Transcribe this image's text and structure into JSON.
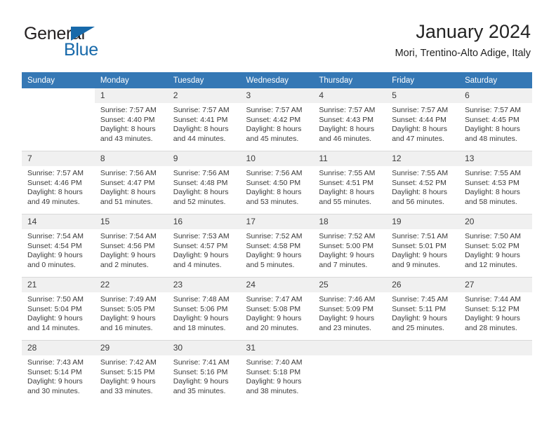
{
  "brand": {
    "name_part1": "General",
    "name_part2": "Blue",
    "triangle_color": "#1769aa"
  },
  "header": {
    "title": "January 2024",
    "subtitle": "Mori, Trentino-Alto Adige, Italy",
    "header_bg": "#3578b5",
    "daynum_bg": "#f0f0f0"
  },
  "weekdays": [
    "Sunday",
    "Monday",
    "Tuesday",
    "Wednesday",
    "Thursday",
    "Friday",
    "Saturday"
  ],
  "weeks": [
    [
      {
        "day": "",
        "blank": true,
        "l1": "",
        "l2": "",
        "l3": "",
        "l4": ""
      },
      {
        "day": "1",
        "l1": "Sunrise: 7:57 AM",
        "l2": "Sunset: 4:40 PM",
        "l3": "Daylight: 8 hours",
        "l4": "and 43 minutes."
      },
      {
        "day": "2",
        "l1": "Sunrise: 7:57 AM",
        "l2": "Sunset: 4:41 PM",
        "l3": "Daylight: 8 hours",
        "l4": "and 44 minutes."
      },
      {
        "day": "3",
        "l1": "Sunrise: 7:57 AM",
        "l2": "Sunset: 4:42 PM",
        "l3": "Daylight: 8 hours",
        "l4": "and 45 minutes."
      },
      {
        "day": "4",
        "l1": "Sunrise: 7:57 AM",
        "l2": "Sunset: 4:43 PM",
        "l3": "Daylight: 8 hours",
        "l4": "and 46 minutes."
      },
      {
        "day": "5",
        "l1": "Sunrise: 7:57 AM",
        "l2": "Sunset: 4:44 PM",
        "l3": "Daylight: 8 hours",
        "l4": "and 47 minutes."
      },
      {
        "day": "6",
        "l1": "Sunrise: 7:57 AM",
        "l2": "Sunset: 4:45 PM",
        "l3": "Daylight: 8 hours",
        "l4": "and 48 minutes."
      }
    ],
    [
      {
        "day": "7",
        "l1": "Sunrise: 7:57 AM",
        "l2": "Sunset: 4:46 PM",
        "l3": "Daylight: 8 hours",
        "l4": "and 49 minutes."
      },
      {
        "day": "8",
        "l1": "Sunrise: 7:56 AM",
        "l2": "Sunset: 4:47 PM",
        "l3": "Daylight: 8 hours",
        "l4": "and 51 minutes."
      },
      {
        "day": "9",
        "l1": "Sunrise: 7:56 AM",
        "l2": "Sunset: 4:48 PM",
        "l3": "Daylight: 8 hours",
        "l4": "and 52 minutes."
      },
      {
        "day": "10",
        "l1": "Sunrise: 7:56 AM",
        "l2": "Sunset: 4:50 PM",
        "l3": "Daylight: 8 hours",
        "l4": "and 53 minutes."
      },
      {
        "day": "11",
        "l1": "Sunrise: 7:55 AM",
        "l2": "Sunset: 4:51 PM",
        "l3": "Daylight: 8 hours",
        "l4": "and 55 minutes."
      },
      {
        "day": "12",
        "l1": "Sunrise: 7:55 AM",
        "l2": "Sunset: 4:52 PM",
        "l3": "Daylight: 8 hours",
        "l4": "and 56 minutes."
      },
      {
        "day": "13",
        "l1": "Sunrise: 7:55 AM",
        "l2": "Sunset: 4:53 PM",
        "l3": "Daylight: 8 hours",
        "l4": "and 58 minutes."
      }
    ],
    [
      {
        "day": "14",
        "l1": "Sunrise: 7:54 AM",
        "l2": "Sunset: 4:54 PM",
        "l3": "Daylight: 9 hours",
        "l4": "and 0 minutes."
      },
      {
        "day": "15",
        "l1": "Sunrise: 7:54 AM",
        "l2": "Sunset: 4:56 PM",
        "l3": "Daylight: 9 hours",
        "l4": "and 2 minutes."
      },
      {
        "day": "16",
        "l1": "Sunrise: 7:53 AM",
        "l2": "Sunset: 4:57 PM",
        "l3": "Daylight: 9 hours",
        "l4": "and 4 minutes."
      },
      {
        "day": "17",
        "l1": "Sunrise: 7:52 AM",
        "l2": "Sunset: 4:58 PM",
        "l3": "Daylight: 9 hours",
        "l4": "and 5 minutes."
      },
      {
        "day": "18",
        "l1": "Sunrise: 7:52 AM",
        "l2": "Sunset: 5:00 PM",
        "l3": "Daylight: 9 hours",
        "l4": "and 7 minutes."
      },
      {
        "day": "19",
        "l1": "Sunrise: 7:51 AM",
        "l2": "Sunset: 5:01 PM",
        "l3": "Daylight: 9 hours",
        "l4": "and 9 minutes."
      },
      {
        "day": "20",
        "l1": "Sunrise: 7:50 AM",
        "l2": "Sunset: 5:02 PM",
        "l3": "Daylight: 9 hours",
        "l4": "and 12 minutes."
      }
    ],
    [
      {
        "day": "21",
        "l1": "Sunrise: 7:50 AM",
        "l2": "Sunset: 5:04 PM",
        "l3": "Daylight: 9 hours",
        "l4": "and 14 minutes."
      },
      {
        "day": "22",
        "l1": "Sunrise: 7:49 AM",
        "l2": "Sunset: 5:05 PM",
        "l3": "Daylight: 9 hours",
        "l4": "and 16 minutes."
      },
      {
        "day": "23",
        "l1": "Sunrise: 7:48 AM",
        "l2": "Sunset: 5:06 PM",
        "l3": "Daylight: 9 hours",
        "l4": "and 18 minutes."
      },
      {
        "day": "24",
        "l1": "Sunrise: 7:47 AM",
        "l2": "Sunset: 5:08 PM",
        "l3": "Daylight: 9 hours",
        "l4": "and 20 minutes."
      },
      {
        "day": "25",
        "l1": "Sunrise: 7:46 AM",
        "l2": "Sunset: 5:09 PM",
        "l3": "Daylight: 9 hours",
        "l4": "and 23 minutes."
      },
      {
        "day": "26",
        "l1": "Sunrise: 7:45 AM",
        "l2": "Sunset: 5:11 PM",
        "l3": "Daylight: 9 hours",
        "l4": "and 25 minutes."
      },
      {
        "day": "27",
        "l1": "Sunrise: 7:44 AM",
        "l2": "Sunset: 5:12 PM",
        "l3": "Daylight: 9 hours",
        "l4": "and 28 minutes."
      }
    ],
    [
      {
        "day": "28",
        "l1": "Sunrise: 7:43 AM",
        "l2": "Sunset: 5:14 PM",
        "l3": "Daylight: 9 hours",
        "l4": "and 30 minutes."
      },
      {
        "day": "29",
        "l1": "Sunrise: 7:42 AM",
        "l2": "Sunset: 5:15 PM",
        "l3": "Daylight: 9 hours",
        "l4": "and 33 minutes."
      },
      {
        "day": "30",
        "l1": "Sunrise: 7:41 AM",
        "l2": "Sunset: 5:16 PM",
        "l3": "Daylight: 9 hours",
        "l4": "and 35 minutes."
      },
      {
        "day": "31",
        "l1": "Sunrise: 7:40 AM",
        "l2": "Sunset: 5:18 PM",
        "l3": "Daylight: 9 hours",
        "l4": "and 38 minutes."
      },
      {
        "day": "",
        "l1": "",
        "l2": "",
        "l3": "",
        "l4": ""
      },
      {
        "day": "",
        "l1": "",
        "l2": "",
        "l3": "",
        "l4": ""
      },
      {
        "day": "",
        "l1": "",
        "l2": "",
        "l3": "",
        "l4": ""
      }
    ]
  ]
}
